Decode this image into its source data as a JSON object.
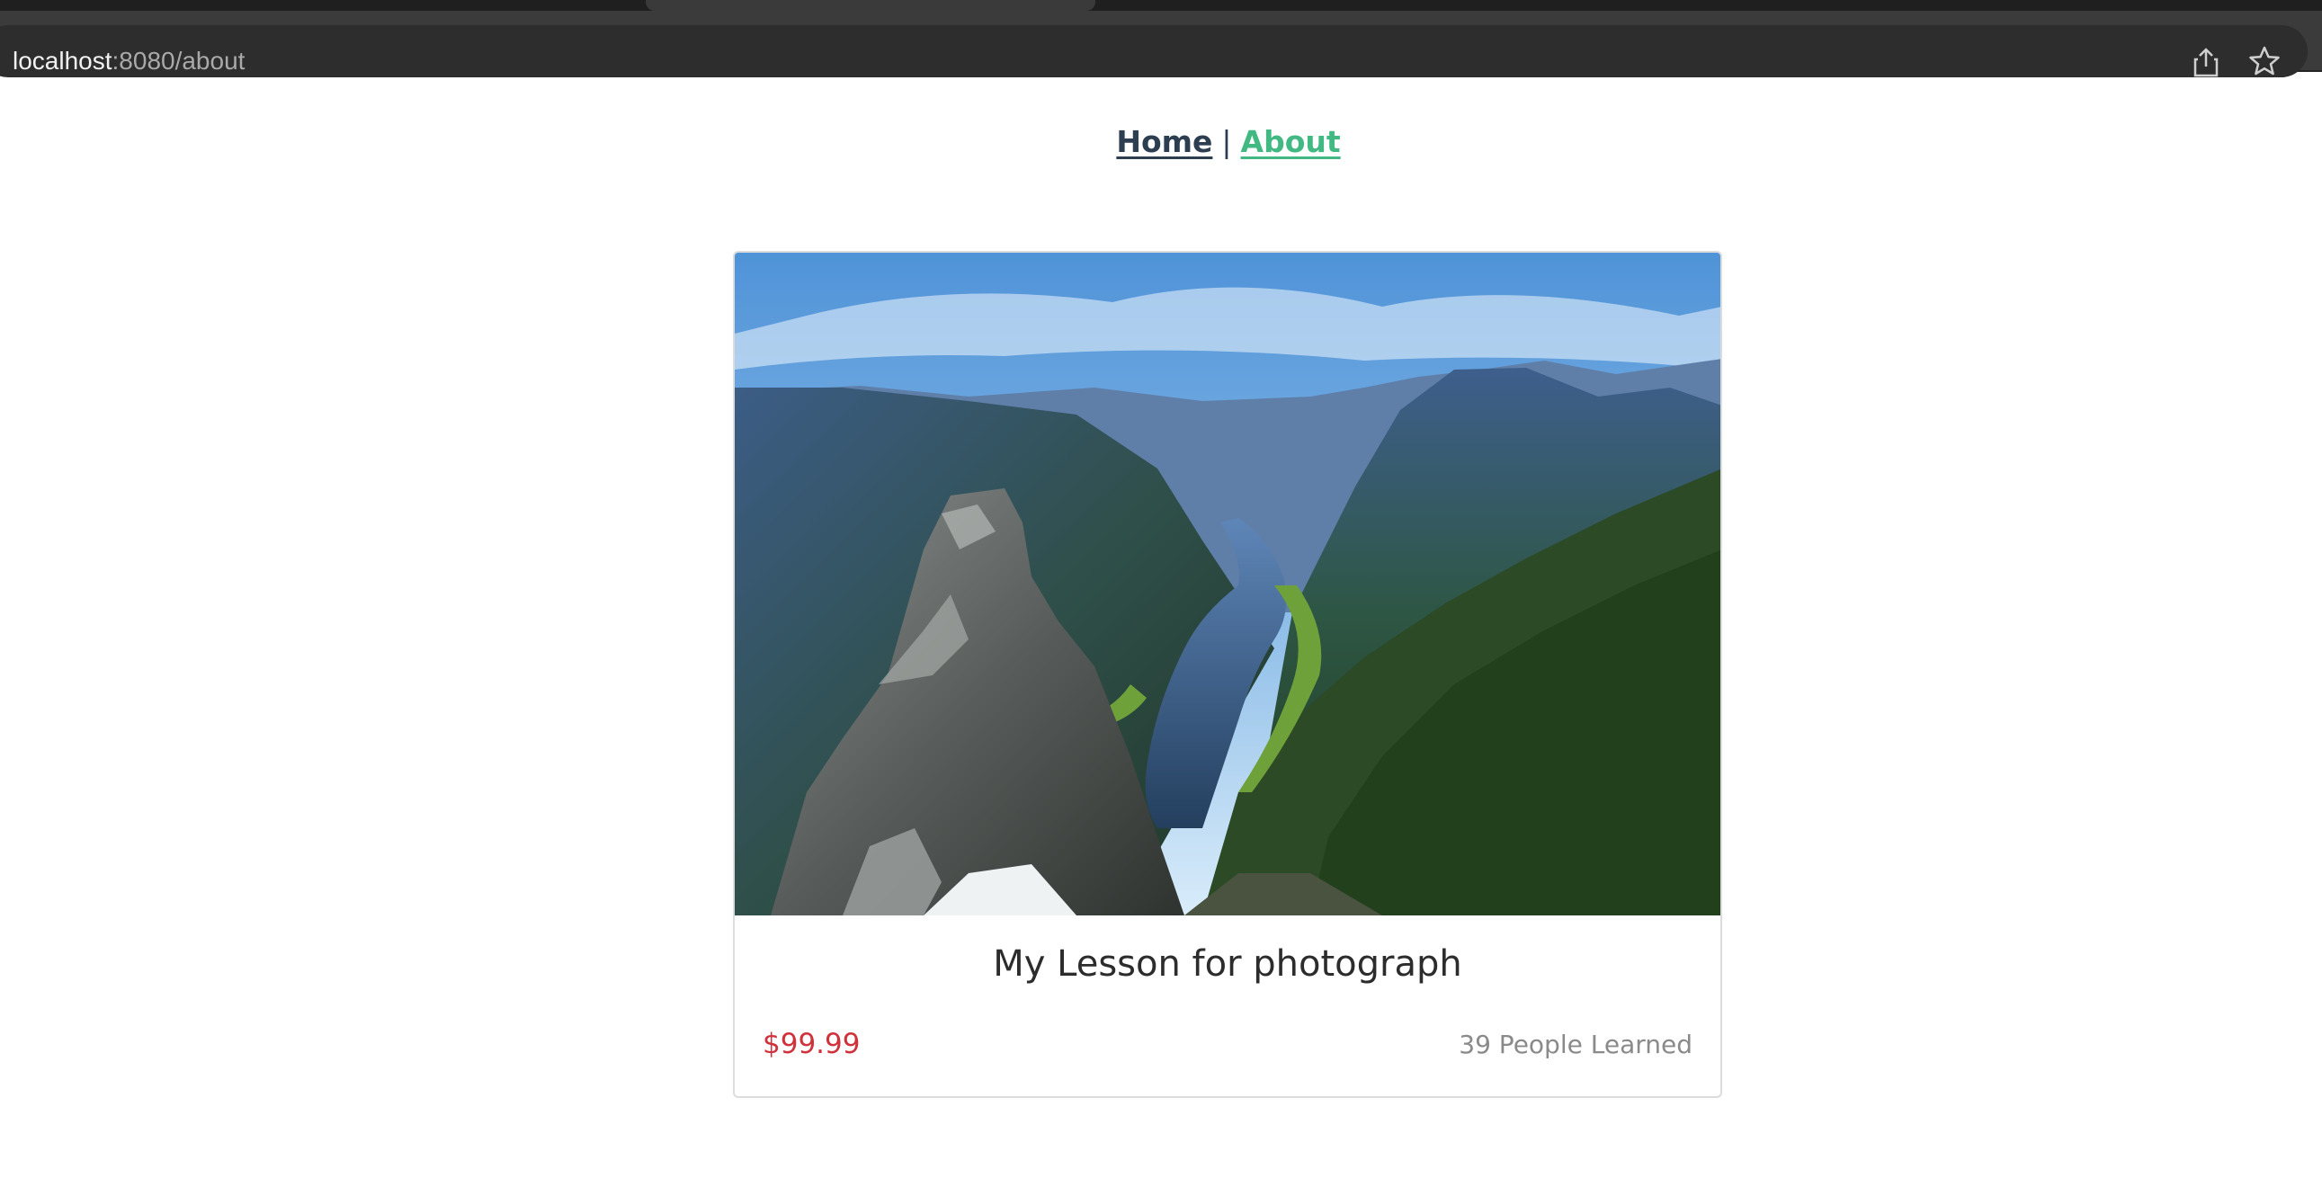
{
  "browser": {
    "url_host": "localhost",
    "url_rest": ":8080/about",
    "share_icon": "share-icon",
    "bookmark_icon": "star-icon"
  },
  "nav": {
    "home_label": "Home",
    "separator": "|",
    "about_label": "About",
    "active": "About"
  },
  "card": {
    "image_icon": "mountain-fjord-photo",
    "title": "My Lesson for photograph",
    "price": "$99.99",
    "learned": "39 People Learned"
  },
  "colors": {
    "nav_text": "#2c3e50",
    "nav_active": "#42b983",
    "price": "#d0323c",
    "muted": "#8a8a8a"
  }
}
